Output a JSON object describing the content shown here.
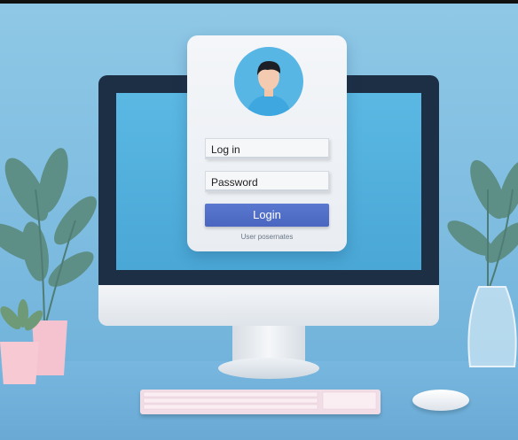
{
  "login": {
    "username_placeholder": "Log in",
    "password_placeholder": "Password",
    "button_label": "Login",
    "hint_text": "User posernates"
  },
  "colors": {
    "background": "#7dbbe0",
    "monitor_bezel": "#1d2f44",
    "screen": "#4aa7d6",
    "button": "#4a66c0",
    "avatar_bg": "#58b6e4",
    "keyboard": "#f1dde6",
    "leaf": "#5d8f86"
  },
  "icons": {
    "avatar": "user-avatar-icon"
  }
}
